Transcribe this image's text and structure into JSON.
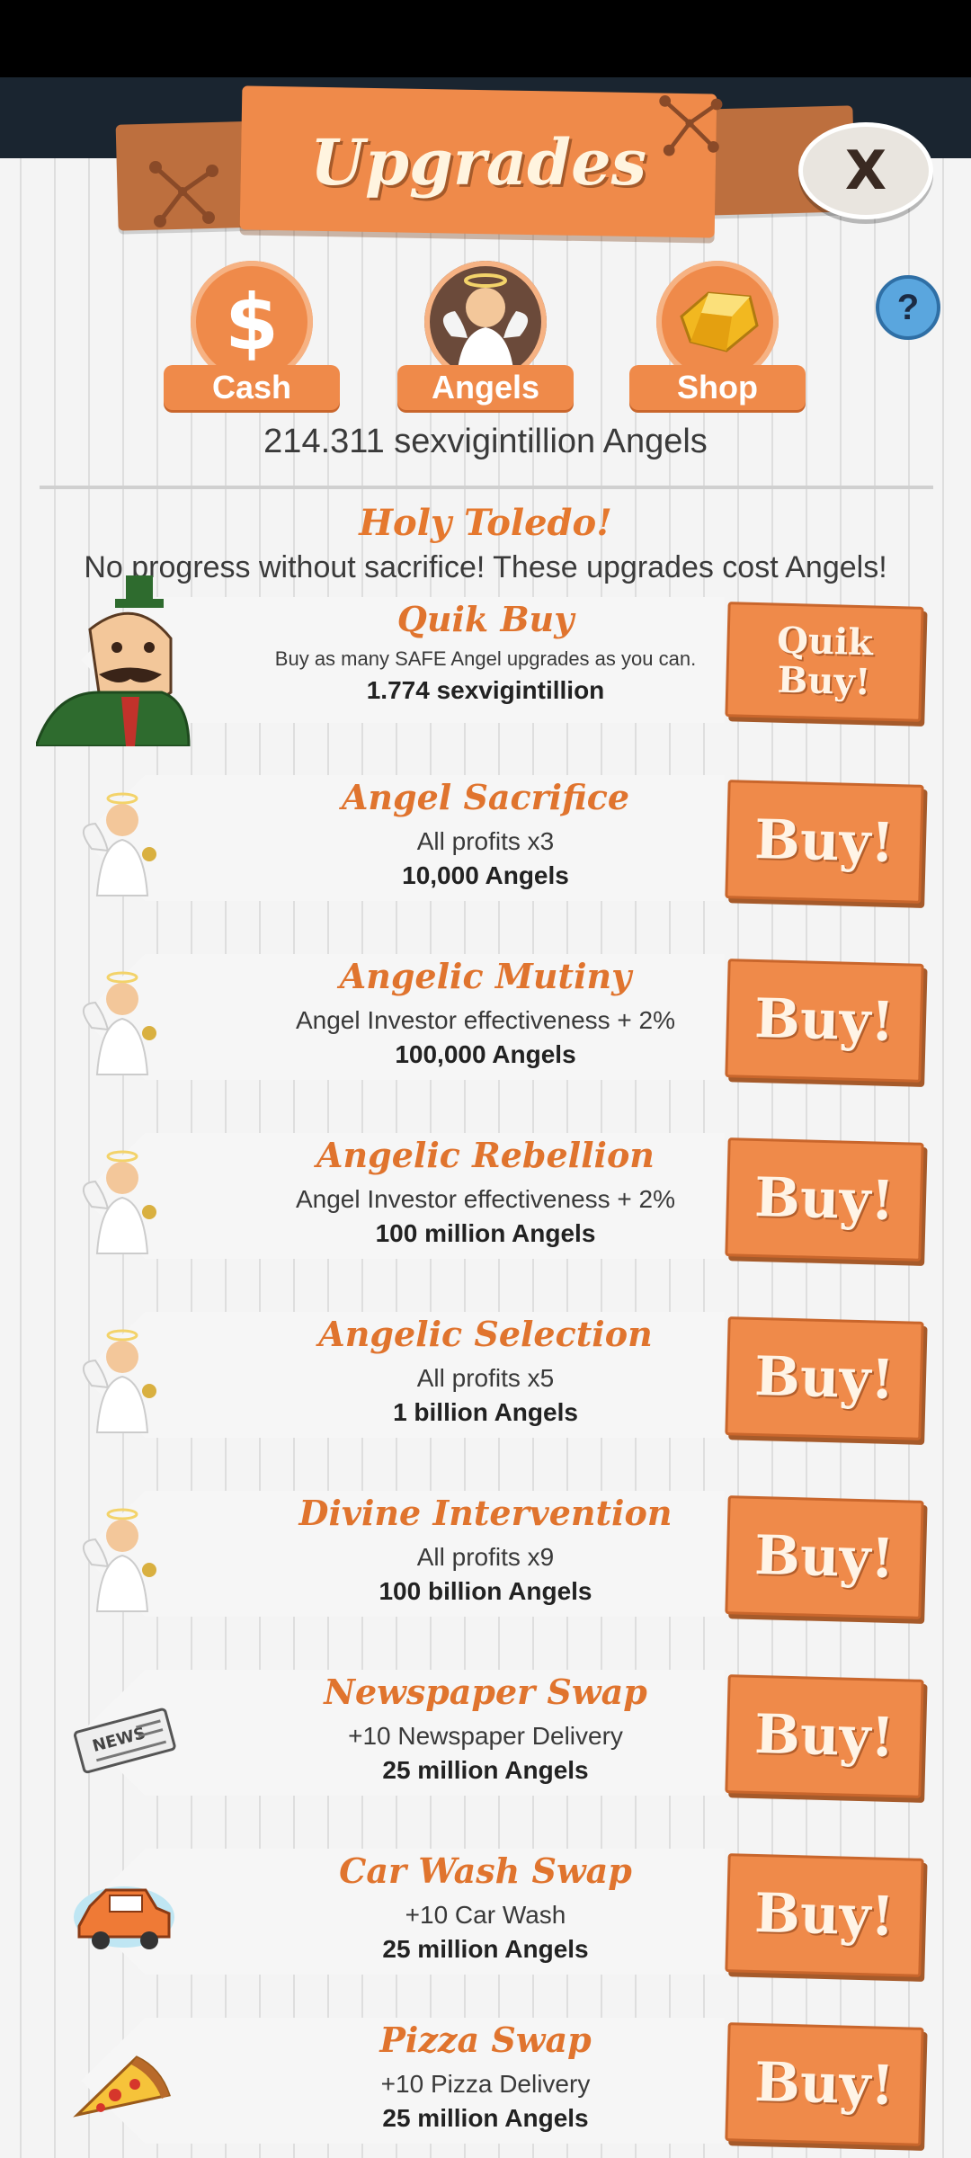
{
  "header": {
    "title": "Upgrades",
    "close_label": "X"
  },
  "categories": [
    {
      "label": "Cash",
      "icon": "dollar-icon"
    },
    {
      "label": "Angels",
      "icon": "angel-icon",
      "active": true
    },
    {
      "label": "Shop",
      "icon": "gold-gem-icon"
    }
  ],
  "help_label": "?",
  "balance_text": "214.311 sexvigintillion Angels",
  "intro": {
    "heading": "Holy Toledo!",
    "text": "No progress without sacrifice! These upgrades cost Angels!"
  },
  "quik_buy": {
    "name": "Quik Buy",
    "description": "Buy as many SAFE Angel upgrades as you can.",
    "cost": "1.774 sexvigintillion",
    "button_line1": "Quik",
    "button_line2": "Buy!"
  },
  "upgrades": [
    {
      "name": "Angel Sacrifice",
      "description": "All profits x3",
      "cost": "10,000 Angels",
      "button": "Buy!",
      "icon": "angel-icon"
    },
    {
      "name": "Angelic Mutiny",
      "description": "Angel Investor effectiveness + 2%",
      "cost": "100,000 Angels",
      "button": "Buy!",
      "icon": "angel-icon"
    },
    {
      "name": "Angelic Rebellion",
      "description": "Angel Investor effectiveness + 2%",
      "cost": "100 million Angels",
      "button": "Buy!",
      "icon": "angel-icon"
    },
    {
      "name": "Angelic Selection",
      "description": "All profits x5",
      "cost": "1 billion Angels",
      "button": "Buy!",
      "icon": "angel-icon"
    },
    {
      "name": "Divine Intervention",
      "description": "All profits x9",
      "cost": "100 billion Angels",
      "button": "Buy!",
      "icon": "angel-icon"
    },
    {
      "name": "Newspaper Swap",
      "description": "+10 Newspaper Delivery",
      "cost": "25 million Angels",
      "button": "Buy!",
      "icon": "newspaper-icon"
    },
    {
      "name": "Car Wash Swap",
      "description": "+10 Car Wash",
      "cost": "25 million Angels",
      "button": "Buy!",
      "icon": "car-icon"
    },
    {
      "name": "Pizza Swap",
      "description": "+10 Pizza Delivery",
      "cost": "25 million Angels",
      "button": "Buy!",
      "icon": "pizza-icon"
    }
  ],
  "colors": {
    "accent": "#ef8a4a",
    "title_text": "#e0742e",
    "panel": "#f2f2f2"
  }
}
